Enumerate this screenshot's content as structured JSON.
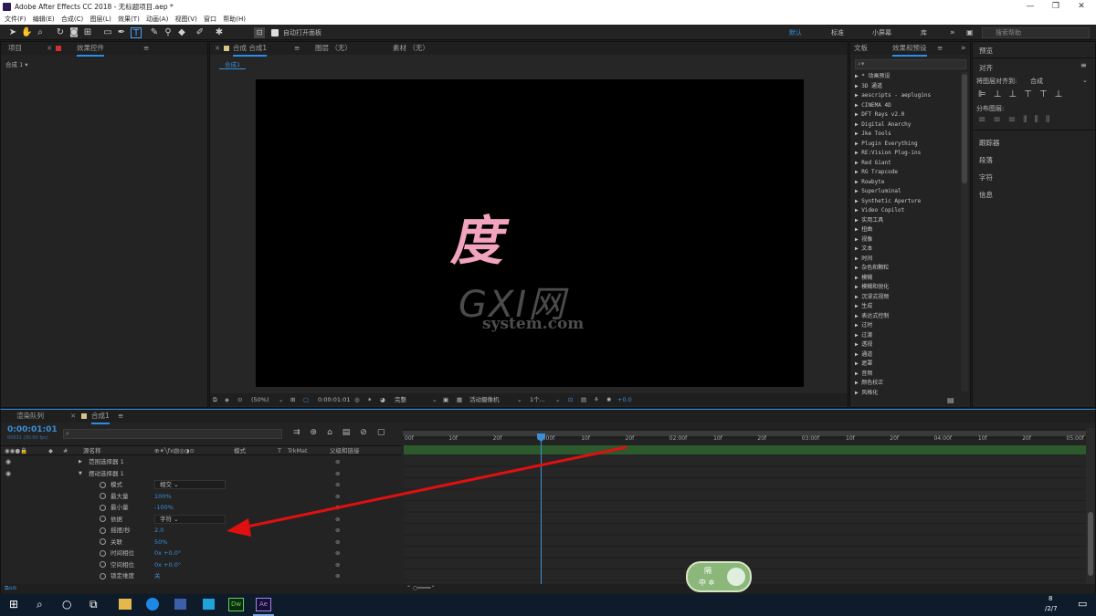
{
  "window": {
    "title": "Adobe After Effects CC 2018 - 无标题项目.aep *",
    "minimize": "—",
    "maximize": "❐",
    "close": "✕"
  },
  "menu": [
    "文件(F)",
    "编辑(E)",
    "合成(C)",
    "图层(L)",
    "效果(T)",
    "动画(A)",
    "视图(V)",
    "窗口",
    "帮助(H)"
  ],
  "toolbar": {
    "auto_open_label": "自动打开面板",
    "workspaces": [
      "默认",
      "标准",
      "小屏幕",
      "库"
    ],
    "search_placeholder": "搜索帮助"
  },
  "project_panel": {
    "tab_project": "项目",
    "tab_effect": "效果控件",
    "breadcrumb": "合成 1 ▾"
  },
  "comp_panel": {
    "tab_comp": "合成 合成1",
    "tab_layer": "图层 （无）",
    "tab_footage": "素材 （无）",
    "comp_tab": "合成1",
    "text_char": "度",
    "watermark_main": "GXI网",
    "watermark_sub": "system.com",
    "zoom": "(50%)",
    "timecode": "0:00:01:01",
    "quality": "完整",
    "camera": "活动摄像机",
    "views": "1个...",
    "exposure": "+0.0"
  },
  "effects_panel": {
    "tab_info": "文板",
    "tab_effects": "效果和预设",
    "items": [
      "* 动画预设",
      "3D 通道",
      "aescripts - aeplugins",
      "CINEMA 4D",
      "DFT Rays v2.0",
      "Digital Anarchy",
      "Jke Tools",
      "Plugin Everything",
      "RE:Vision Plug-ins",
      "Red Giant",
      "RG Trapcode",
      "Rowbyte",
      "Superluminal",
      "Synthetic Aperture",
      "Video Copilot",
      "实用工具",
      "扭曲",
      "视像",
      "文本",
      "时间",
      "杂色和颗粒",
      "模糊",
      "模糊和锐化",
      "沉浸式视频",
      "生成",
      "表达式控制",
      "过时",
      "过渡",
      "透视",
      "通道",
      "遮罩",
      "音频",
      "颜色校正",
      "风格化"
    ]
  },
  "right_panel": {
    "tab_preview": "预览",
    "align": "对齐",
    "align_to_label": "将图层对齐到:",
    "align_to_value": "合成",
    "distribute": "分布图层:",
    "sections": [
      "跟踪器",
      "段落",
      "字符",
      "信息"
    ]
  },
  "timeline": {
    "tab_render": "渲染队列",
    "tab_comp": "合成1",
    "timecode": "0:00:01:01",
    "timecode_sub": "00031 (30.00 fps)",
    "col_name": "源名称",
    "col_mode": "模式",
    "col_t": "T",
    "col_trkmat": "TrkMat",
    "col_parent": "父级和链接",
    "ruler": [
      "00f",
      "10f",
      "20f",
      "01:00f",
      "10f",
      "20f",
      "02:00f",
      "10f",
      "20f",
      "03:00f",
      "10f",
      "20f",
      "04:00f",
      "10f",
      "20f",
      "05:00f"
    ],
    "rows": [
      {
        "label": "范围选择器 1",
        "value": "",
        "indent": 1
      },
      {
        "label": "摆动选择器 1",
        "value": "",
        "indent": 1
      },
      {
        "label": "模式",
        "value": "相交",
        "indent": 2
      },
      {
        "label": "最大量",
        "value": "100%",
        "indent": 2
      },
      {
        "label": "最小量",
        "value": "-100%",
        "indent": 2
      },
      {
        "label": "依据",
        "value": "字符",
        "indent": 2
      },
      {
        "label": "摇摆/秒",
        "value": "2.0",
        "indent": 2
      },
      {
        "label": "关联",
        "value": "50%",
        "indent": 2
      },
      {
        "label": "时间相位",
        "value": "0x +0.0°",
        "indent": 2
      },
      {
        "label": "空间相位",
        "value": "0x +0.0°",
        "indent": 2
      },
      {
        "label": "锁定维度",
        "value": "关",
        "indent": 2
      }
    ]
  },
  "badge": {
    "line1": "隔",
    "line2": "中 ✲"
  },
  "taskbar": {
    "apps": [
      "Dw",
      "Ae"
    ],
    "time": "8",
    "date": "/2/7"
  },
  "colors": {
    "accent": "#2d8ceb",
    "text_pink": "#f2a3bd",
    "arrow": "#e01010"
  }
}
